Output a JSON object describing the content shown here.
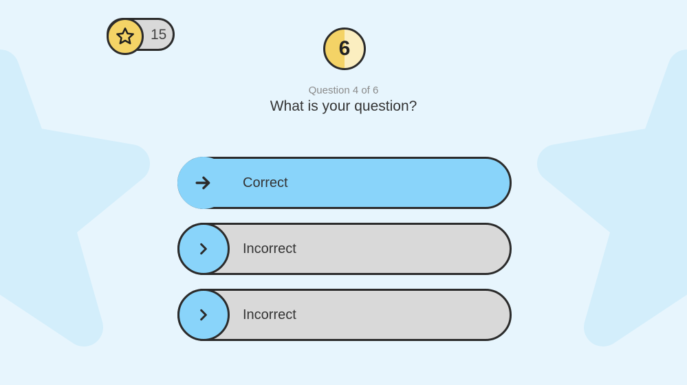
{
  "score": {
    "value": "15",
    "icon": "star-icon",
    "badge_color": "#f4d366"
  },
  "timer": {
    "value": "6",
    "progress": 0.5
  },
  "question": {
    "meta": "Question 4 of 6",
    "text": "What is your question?"
  },
  "answers": [
    {
      "label": "Correct",
      "state": "correct",
      "icon": "arrow-right-icon"
    },
    {
      "label": "Incorrect",
      "state": "default",
      "icon": "chevron-right-icon"
    },
    {
      "label": "Incorrect",
      "state": "default",
      "icon": "chevron-right-icon"
    }
  ],
  "colors": {
    "background": "#e7f5fd",
    "background_star": "#d3eefb",
    "accent_blue": "#89d4fa",
    "accent_yellow": "#f4d366",
    "neutral_gray": "#d9d9d9",
    "outline": "#2b2b2b"
  }
}
